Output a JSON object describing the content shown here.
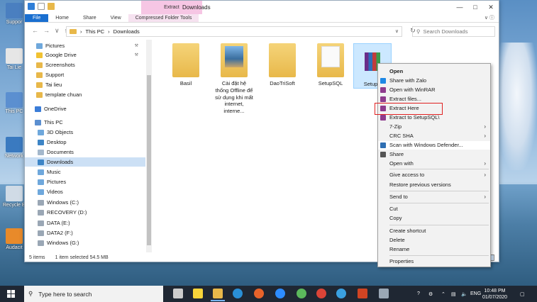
{
  "desktop": {
    "icons": [
      {
        "label": "Suppor",
        "color": "#4a7fc0"
      },
      {
        "label": "Tai Lie",
        "color": "#e6e6e6"
      },
      {
        "label": "This PC",
        "color": "#5b8fd0"
      },
      {
        "label": "Network",
        "color": "#3a7ac0"
      },
      {
        "label": "Recycle Bi",
        "color": "#d0dbe6"
      },
      {
        "label": "Audacit",
        "color": "#e88a2a"
      }
    ]
  },
  "window": {
    "title": "Downloads",
    "contextual_tab": "Extract",
    "ribbon_tabs": [
      "File",
      "Home",
      "Share",
      "View",
      "Compressed Folder Tools"
    ],
    "address": {
      "root": "This PC",
      "current": "Downloads"
    },
    "search_placeholder": "Search Downloads"
  },
  "nav_pane": {
    "items": [
      {
        "label": "Pictures",
        "color": "#6fa8dc",
        "pinned": true
      },
      {
        "label": "Google Drive",
        "color": "#f1c232",
        "pinned": true
      },
      {
        "label": "Screenshots",
        "color": "#e8b84a",
        "pinned": false
      },
      {
        "label": "Support",
        "color": "#e8b84a",
        "pinned": false
      },
      {
        "label": "Tai lieu",
        "color": "#e8b84a",
        "pinned": false
      },
      {
        "label": "template chuan",
        "color": "#e8b84a",
        "pinned": false
      },
      {
        "label": "OneDrive",
        "color": "#3b7dd8",
        "pinned": false
      },
      {
        "label": "This PC",
        "color": "#5b8fd0",
        "pinned": false
      },
      {
        "label": "3D Objects",
        "color": "#6fa8dc",
        "pinned": false
      },
      {
        "label": "Desktop",
        "color": "#3d85c6",
        "pinned": false
      },
      {
        "label": "Documents",
        "color": "#a4b8cc",
        "pinned": false
      },
      {
        "label": "Downloads",
        "color": "#3d85c6",
        "pinned": false,
        "selected": true
      },
      {
        "label": "Music",
        "color": "#6fa8dc",
        "pinned": false
      },
      {
        "label": "Pictures",
        "color": "#6fa8dc",
        "pinned": false
      },
      {
        "label": "Videos",
        "color": "#6fa8dc",
        "pinned": false
      },
      {
        "label": "Windows (C:)",
        "color": "#9aa7b5",
        "pinned": false
      },
      {
        "label": "RECOVERY (D:)",
        "color": "#9aa7b5",
        "pinned": false
      },
      {
        "label": "DATA (E:)",
        "color": "#9aa7b5",
        "pinned": false
      },
      {
        "label": "DATA2 (F:)",
        "color": "#9aa7b5",
        "pinned": false
      },
      {
        "label": "Windows (G:)",
        "color": "#9aa7b5",
        "pinned": false
      }
    ]
  },
  "files": [
    {
      "name": "Basil",
      "kind": "folder"
    },
    {
      "name": "Cài đặt hệ thống Offline để sử dụng khi mất internet, interne...",
      "kind": "image-folder"
    },
    {
      "name": "DaoTriSoft",
      "kind": "folder"
    },
    {
      "name": "SetupSQL",
      "kind": "doc-folder"
    },
    {
      "name": "SetupS",
      "kind": "rar",
      "selected": true
    }
  ],
  "status": {
    "count": "5 items",
    "selection": "1 item selected  54.5 MB"
  },
  "context_menu": {
    "items": [
      {
        "label": "Open",
        "bold": true,
        "icon": "",
        "arrow": false
      },
      {
        "label": "Share with Zalo",
        "icon": "zalo-icon",
        "color": "#1e88e5",
        "arrow": false
      },
      {
        "label": "Open with WinRAR",
        "icon": "winrar-icon",
        "color": "#8e3b8e",
        "arrow": false
      },
      {
        "label": "Extract files...",
        "icon": "winrar-icon",
        "color": "#8e3b8e",
        "arrow": false
      },
      {
        "label": "Extract Here",
        "icon": "winrar-icon",
        "color": "#8e3b8e",
        "arrow": false,
        "highlighted": true
      },
      {
        "label": "Extract to SetupSQL\\",
        "icon": "winrar-icon",
        "color": "#8e3b8e",
        "arrow": false
      },
      {
        "label": "7-Zip",
        "icon": "",
        "arrow": true
      },
      {
        "label": "CRC SHA",
        "icon": "",
        "arrow": true
      },
      {
        "label": "Scan with Windows Defender...",
        "icon": "shield-icon",
        "color": "#2f6fb3",
        "arrow": false,
        "hover": true
      },
      {
        "label": "Share",
        "icon": "share-icon",
        "color": "#555555",
        "arrow": false
      },
      {
        "label": "Open with",
        "icon": "",
        "arrow": true
      },
      {
        "label": "Give access to",
        "icon": "",
        "arrow": true
      },
      {
        "label": "Restore previous versions",
        "icon": "",
        "arrow": false
      },
      {
        "label": "Send to",
        "icon": "",
        "arrow": true
      },
      {
        "label": "Cut",
        "icon": "",
        "arrow": false
      },
      {
        "label": "Copy",
        "icon": "",
        "arrow": false
      },
      {
        "label": "Create shortcut",
        "icon": "",
        "arrow": false
      },
      {
        "label": "Delete",
        "icon": "",
        "arrow": false
      },
      {
        "label": "Rename",
        "icon": "",
        "arrow": false
      },
      {
        "label": "Properties",
        "icon": "",
        "arrow": false
      }
    ]
  },
  "taskbar": {
    "search_placeholder": "Type here to search",
    "apps": [
      {
        "name": "task-view",
        "color": "#cccccc"
      },
      {
        "name": "sticky-notes",
        "color": "#f7d43a"
      },
      {
        "name": "file-explorer",
        "color": "#e8b84a",
        "active": true
      },
      {
        "name": "edge",
        "color": "#2a8fd6"
      },
      {
        "name": "firefox",
        "color": "#e8632a"
      },
      {
        "name": "zoom",
        "color": "#2d8cff"
      },
      {
        "name": "app-green",
        "color": "#5cb85c"
      },
      {
        "name": "chrome",
        "color": "#db4437"
      },
      {
        "name": "onedrive-sync",
        "color": "#3aa0e0"
      },
      {
        "name": "powerpoint",
        "color": "#d04423"
      },
      {
        "name": "app-grey",
        "color": "#9aa7b5"
      }
    ],
    "language": "ENG",
    "time": "10:48 PM",
    "date": "01/07/2020"
  }
}
